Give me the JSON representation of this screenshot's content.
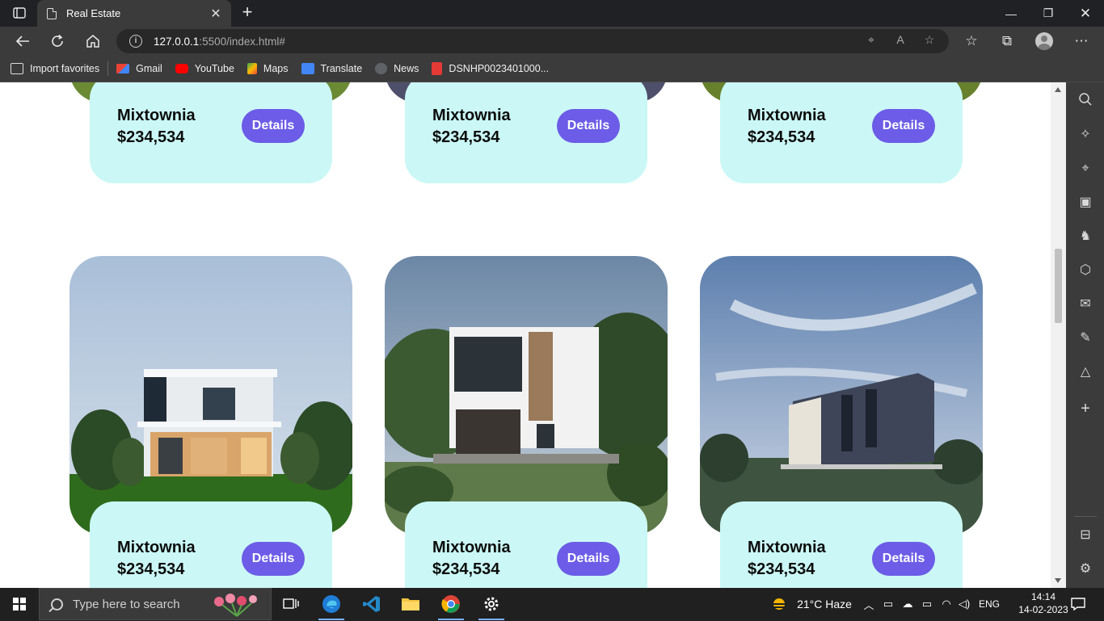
{
  "browser": {
    "tab_title": "Real Estate",
    "url_host": "127.0.0.1",
    "url_path": ":5500/index.html#",
    "favorites": [
      {
        "label": "Import favorites"
      },
      {
        "label": "Gmail"
      },
      {
        "label": "YouTube"
      },
      {
        "label": "Maps"
      },
      {
        "label": "Translate"
      },
      {
        "label": "News"
      },
      {
        "label": "DSNHP0023401000..."
      }
    ]
  },
  "page": {
    "top_cards": [
      {
        "name": "Mixtownia",
        "price": "$234,534",
        "button": "Details"
      },
      {
        "name": "Mixtownia",
        "price": "$234,534",
        "button": "Details"
      },
      {
        "name": "Mixtownia",
        "price": "$234,534",
        "button": "Details"
      }
    ],
    "bottom_cards": [
      {
        "name": "Mixtownia",
        "price": "$234,534",
        "button": "Details"
      },
      {
        "name": "Mixtownia",
        "price": "$234,534",
        "button": "Details"
      },
      {
        "name": "Mixtownia",
        "price": "$234,534",
        "button": "Details"
      }
    ],
    "colors": {
      "card_bg": "#cbf8f6",
      "button_bg": "#6c5ce7"
    }
  },
  "taskbar": {
    "search_placeholder": "Type here to search",
    "weather": "21°C  Haze",
    "language": "ENG",
    "time": "14:14",
    "date": "14-02-2023"
  }
}
